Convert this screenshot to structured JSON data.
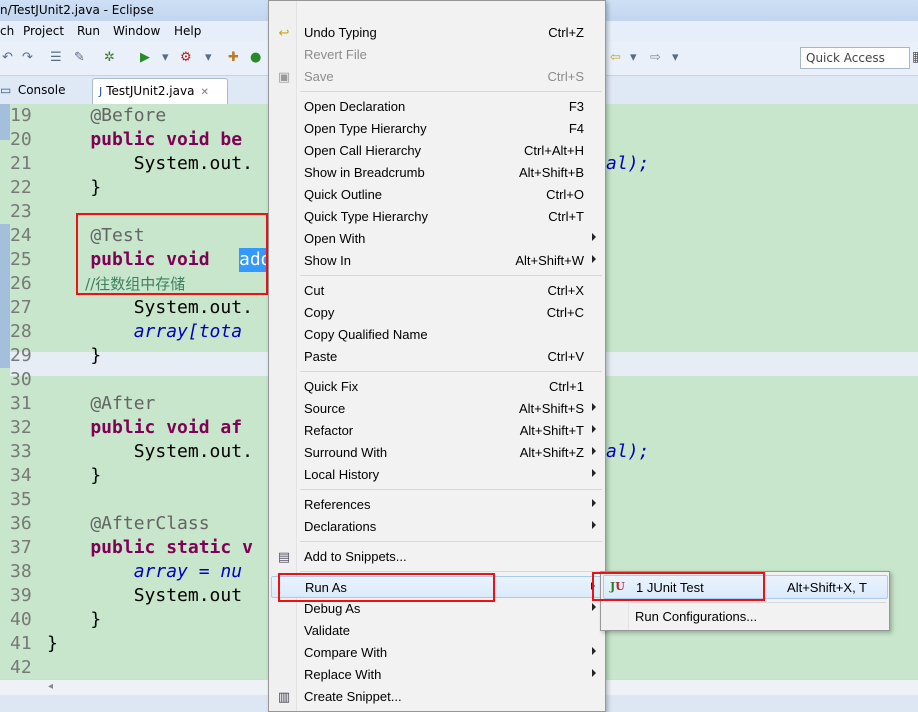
{
  "window": {
    "title": "n/TestJUnit2.java - Eclipse"
  },
  "menubar": {
    "items": [
      "ch",
      "Project",
      "Run",
      "Window",
      "Help"
    ]
  },
  "toolbar": {
    "quick_access": "Quick Access"
  },
  "tabs": {
    "console": "Console",
    "editor": "TestJUnit2.java"
  },
  "editor": {
    "lines": [
      {
        "n": "19",
        "t": "    @Before"
      },
      {
        "n": "20",
        "t": "    public void be"
      },
      {
        "n": "21",
        "t": "        System.out."
      },
      {
        "n": "22",
        "t": "    }"
      },
      {
        "n": "23",
        "t": ""
      },
      {
        "n": "24",
        "t": "    @Test"
      },
      {
        "n": "25",
        "t": "    public void "
      },
      {
        "n": "26",
        "t": "        //往数组中存储"
      },
      {
        "n": "27",
        "t": "        System.out."
      },
      {
        "n": "28",
        "t": "        array[tota"
      },
      {
        "n": "29",
        "t": "    }"
      },
      {
        "n": "30",
        "t": ""
      },
      {
        "n": "31",
        "t": "    @After"
      },
      {
        "n": "32",
        "t": "    public void af"
      },
      {
        "n": "33",
        "t": "        System.out."
      },
      {
        "n": "34",
        "t": "    }"
      },
      {
        "n": "35",
        "t": ""
      },
      {
        "n": "36",
        "t": "    @AfterClass"
      },
      {
        "n": "37",
        "t": "    public static v"
      },
      {
        "n": "38",
        "t": "        array = nu"
      },
      {
        "n": "39",
        "t": "        System.out"
      },
      {
        "n": "40",
        "t": "    }"
      },
      {
        "n": "41",
        "t": "}"
      },
      {
        "n": "42",
        "t": ""
      }
    ],
    "selected_text": "add",
    "right_fragment_1": "al);",
    "right_fragment_2": "al);"
  },
  "context_menu": {
    "items": [
      {
        "label": "Undo Typing",
        "shortcut": "Ctrl+Z"
      },
      {
        "label": "Revert File",
        "shortcut": ""
      },
      {
        "label": "Save",
        "shortcut": "Ctrl+S"
      },
      {
        "label": "Open Declaration",
        "shortcut": "F3"
      },
      {
        "label": "Open Type Hierarchy",
        "shortcut": "F4"
      },
      {
        "label": "Open Call Hierarchy",
        "shortcut": "Ctrl+Alt+H"
      },
      {
        "label": "Show in Breadcrumb",
        "shortcut": "Alt+Shift+B"
      },
      {
        "label": "Quick Outline",
        "shortcut": "Ctrl+O"
      },
      {
        "label": "Quick Type Hierarchy",
        "shortcut": "Ctrl+T"
      },
      {
        "label": "Open With",
        "shortcut": ""
      },
      {
        "label": "Show In",
        "shortcut": "Alt+Shift+W"
      },
      {
        "label": "Cut",
        "shortcut": "Ctrl+X"
      },
      {
        "label": "Copy",
        "shortcut": "Ctrl+C"
      },
      {
        "label": "Copy Qualified Name",
        "shortcut": ""
      },
      {
        "label": "Paste",
        "shortcut": "Ctrl+V"
      },
      {
        "label": "Quick Fix",
        "shortcut": "Ctrl+1"
      },
      {
        "label": "Source",
        "shortcut": "Alt+Shift+S"
      },
      {
        "label": "Refactor",
        "shortcut": "Alt+Shift+T"
      },
      {
        "label": "Surround With",
        "shortcut": "Alt+Shift+Z"
      },
      {
        "label": "Local History",
        "shortcut": ""
      },
      {
        "label": "References",
        "shortcut": ""
      },
      {
        "label": "Declarations",
        "shortcut": ""
      },
      {
        "label": "Add to Snippets...",
        "shortcut": ""
      },
      {
        "label": "Run As",
        "shortcut": ""
      },
      {
        "label": "Debug As",
        "shortcut": ""
      },
      {
        "label": "Validate",
        "shortcut": ""
      },
      {
        "label": "Compare With",
        "shortcut": ""
      },
      {
        "label": "Replace With",
        "shortcut": ""
      },
      {
        "label": "Create Snippet...",
        "shortcut": ""
      }
    ]
  },
  "submenu": {
    "items": [
      {
        "label": "1 JUnit Test",
        "shortcut": "Alt+Shift+X, T"
      },
      {
        "label": "Run Configurations...",
        "shortcut": ""
      }
    ]
  },
  "colors": {
    "editor_bg": "#c7e6cb",
    "highlight": "#e11111",
    "selection": "#3399ff"
  }
}
